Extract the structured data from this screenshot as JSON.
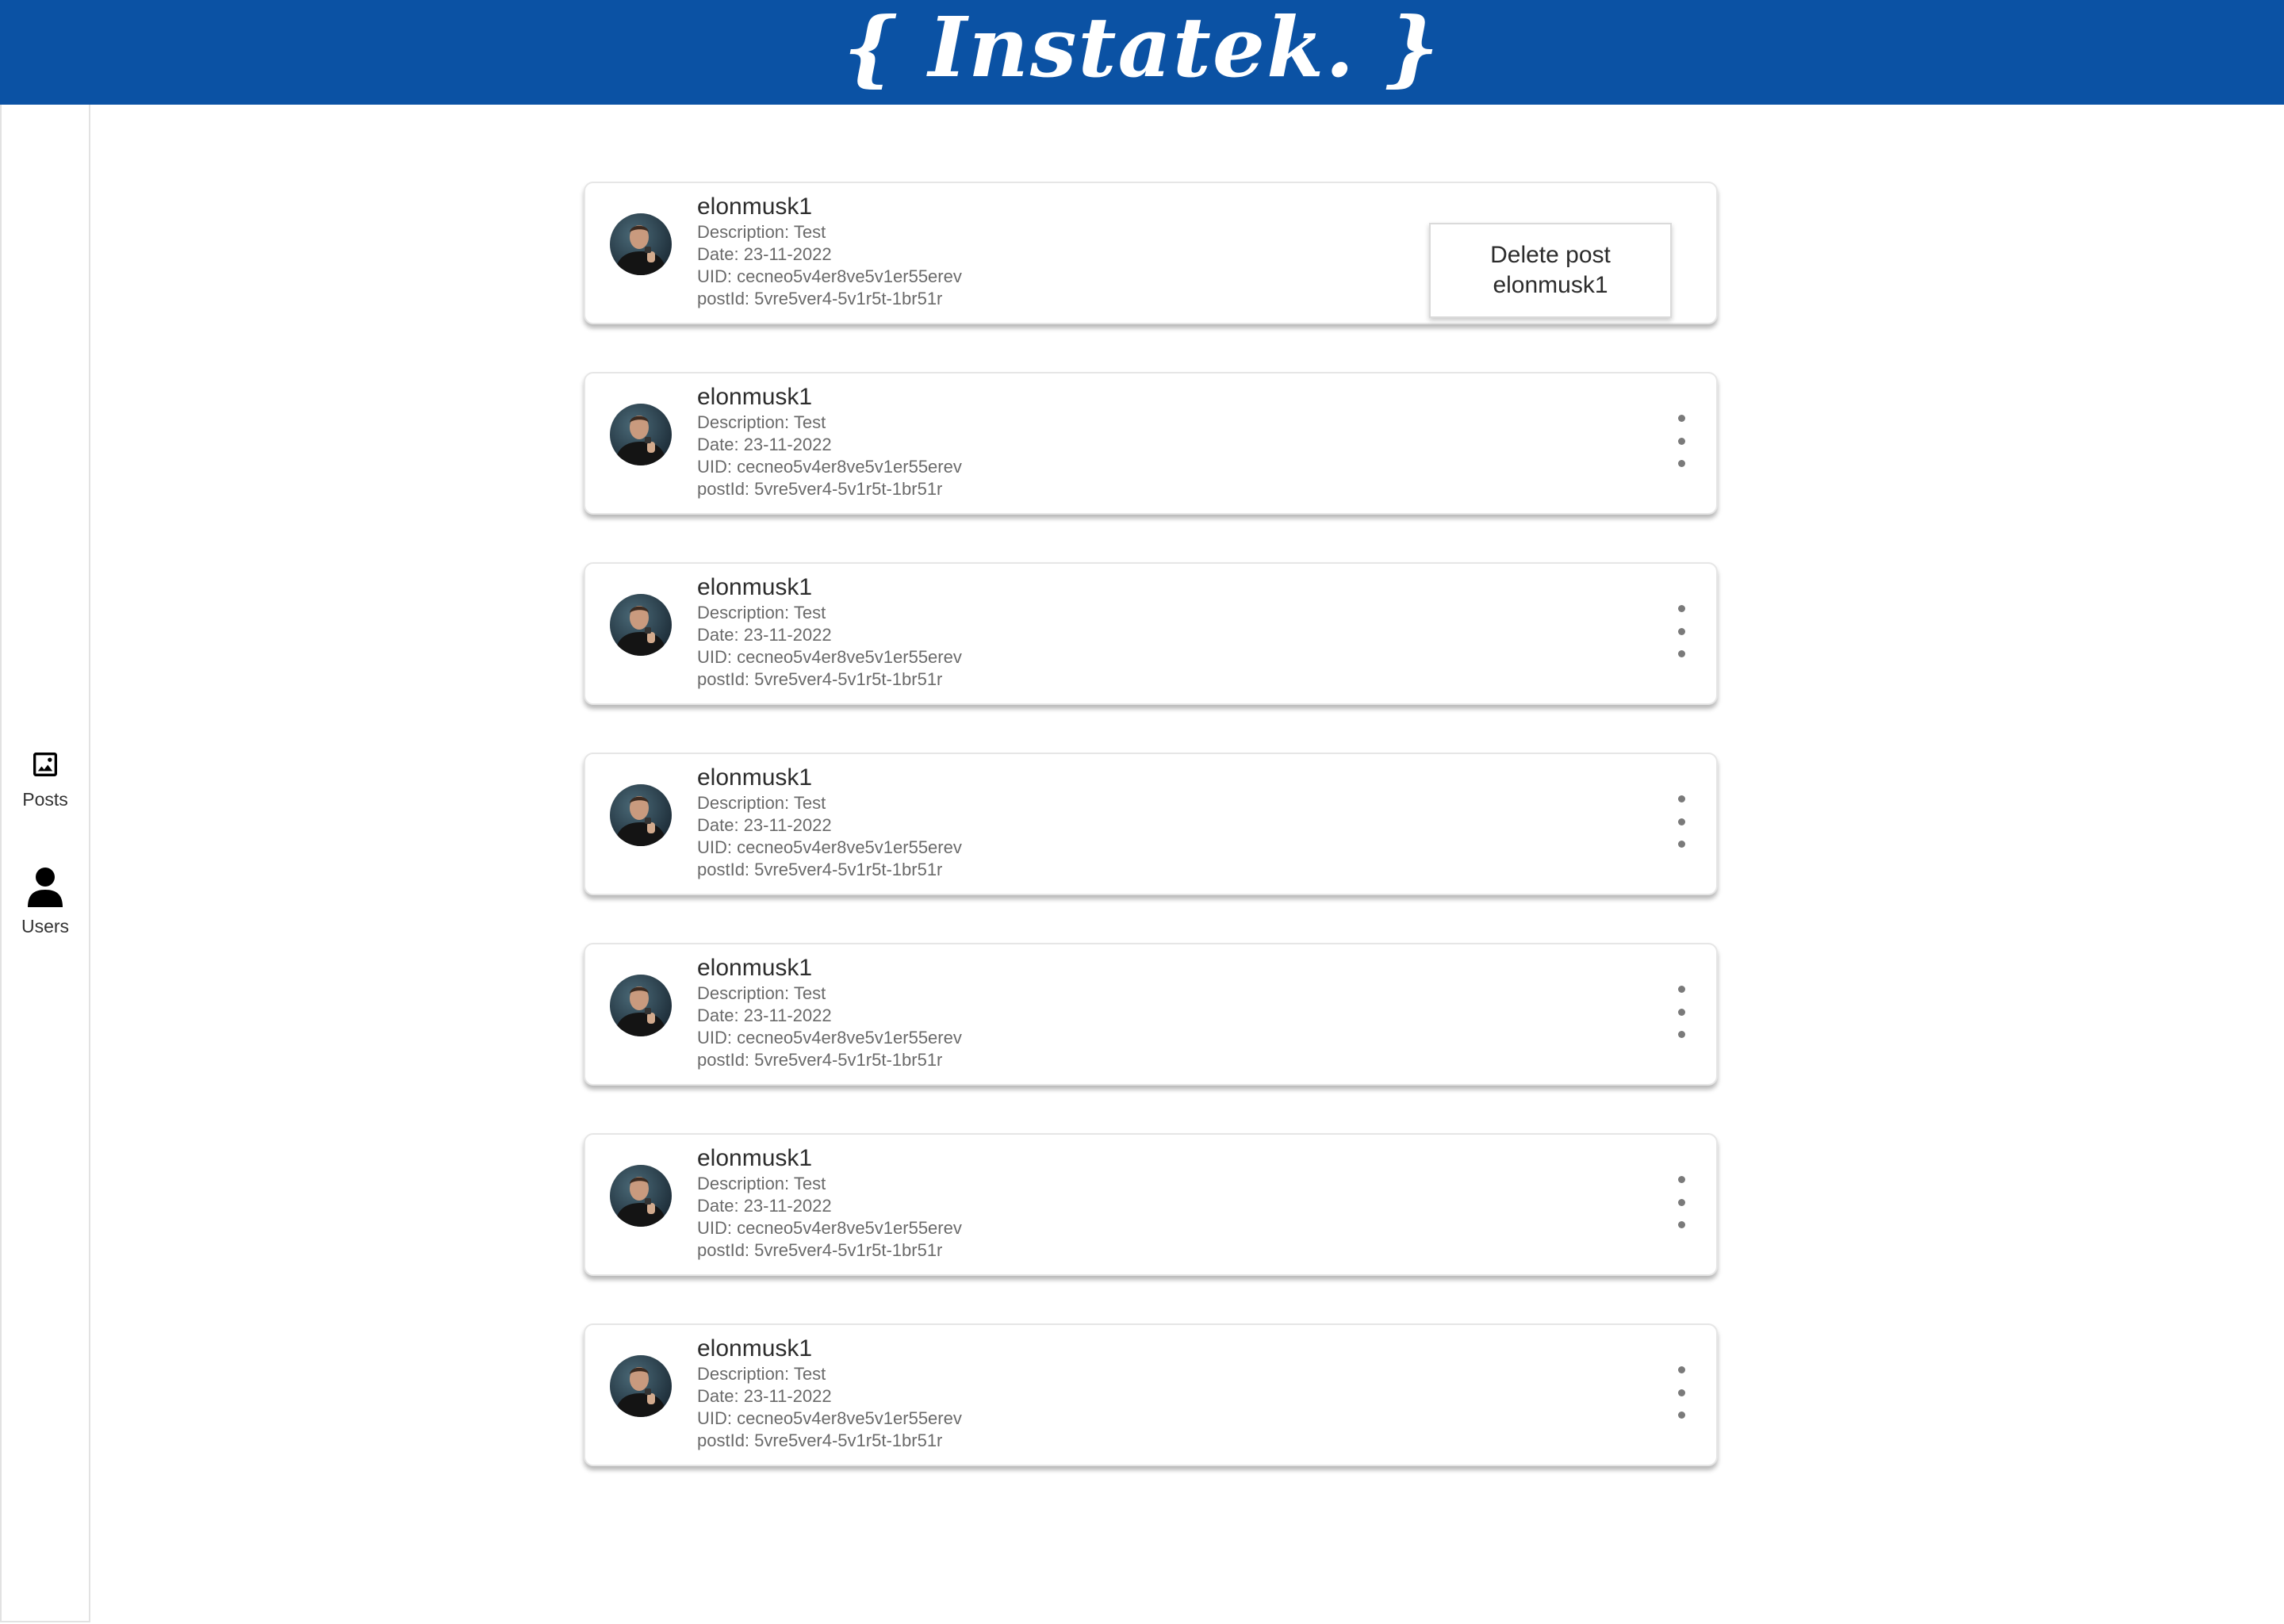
{
  "header": {
    "logo_text": "{ Instatek. }"
  },
  "sidebar": {
    "items": [
      {
        "label": "Posts",
        "icon": "image-icon"
      },
      {
        "label": "Users",
        "icon": "person-icon"
      }
    ]
  },
  "posts": [
    {
      "username": "elonmusk1",
      "description": "Description: Test",
      "date": "Date: 23-11-2022",
      "uid": "UID: cecneo5v4er8ve5v1er55erev",
      "post_id": "postId: 5vre5ver4-5v1r5t-1br51r",
      "menu_open": true,
      "menu_item": "Delete post elonmusk1"
    },
    {
      "username": "elonmusk1",
      "description": "Description: Test",
      "date": "Date: 23-11-2022",
      "uid": "UID: cecneo5v4er8ve5v1er55erev",
      "post_id": "postId: 5vre5ver4-5v1r5t-1br51r",
      "menu_open": false
    },
    {
      "username": "elonmusk1",
      "description": "Description: Test",
      "date": "Date: 23-11-2022",
      "uid": "UID: cecneo5v4er8ve5v1er55erev",
      "post_id": "postId: 5vre5ver4-5v1r5t-1br51r",
      "menu_open": false
    },
    {
      "username": "elonmusk1",
      "description": "Description: Test",
      "date": "Date: 23-11-2022",
      "uid": "UID: cecneo5v4er8ve5v1er55erev",
      "post_id": "postId: 5vre5ver4-5v1r5t-1br51r",
      "menu_open": false
    },
    {
      "username": "elonmusk1",
      "description": "Description: Test",
      "date": "Date: 23-11-2022",
      "uid": "UID: cecneo5v4er8ve5v1er55erev",
      "post_id": "postId: 5vre5ver4-5v1r5t-1br51r",
      "menu_open": false
    },
    {
      "username": "elonmusk1",
      "description": "Description: Test",
      "date": "Date: 23-11-2022",
      "uid": "UID: cecneo5v4er8ve5v1er55erev",
      "post_id": "postId: 5vre5ver4-5v1r5t-1br51r",
      "menu_open": false
    },
    {
      "username": "elonmusk1",
      "description": "Description: Test",
      "date": "Date: 23-11-2022",
      "uid": "UID: cecneo5v4er8ve5v1er55erev",
      "post_id": "postId: 5vre5ver4-5v1r5t-1br51r",
      "menu_open": false
    }
  ],
  "colors": {
    "brand": "#0b52a4",
    "text_primary": "#2c2c2c",
    "text_secondary": "#6a6a6a"
  }
}
